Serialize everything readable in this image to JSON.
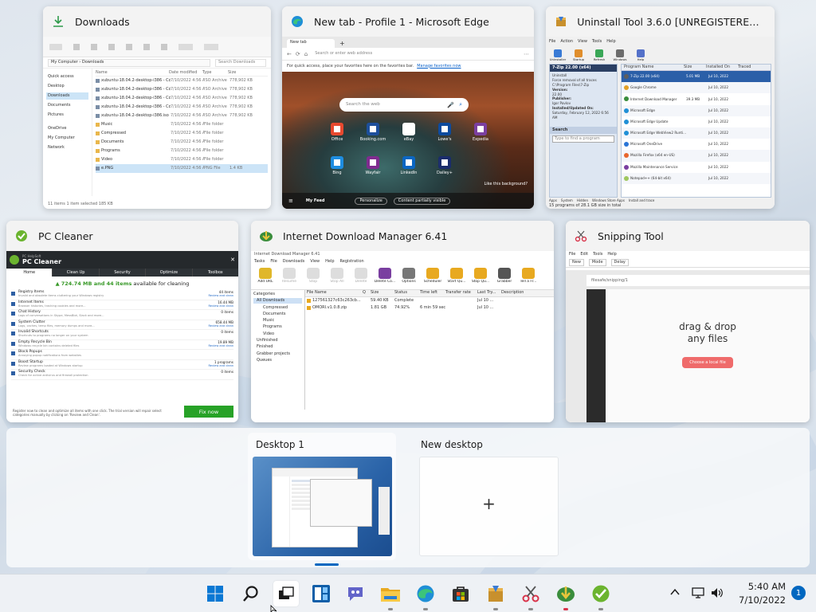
{
  "windows": {
    "downloads": {
      "title": "Downloads",
      "breadcrumb": "My Computer › Downloads",
      "search_placeholder": "Search Downloads",
      "sidebar": [
        "Quick access",
        "Desktop",
        "Downloads",
        "Documents",
        "Pictures",
        "OneDrive",
        "My Computer",
        "Network"
      ],
      "columns": [
        "Name",
        "Date modified",
        "Type",
        "Size"
      ],
      "files": [
        {
          "name": "xubuntu-18.04.2-desktop-i386 - Copy (3)...",
          "date": "7/10/2022 4:56 AM",
          "type": "ISO Archive",
          "size": "778,902 KB"
        },
        {
          "name": "xubuntu-18.04.2-desktop-i386 - Copy (2)...",
          "date": "7/10/2022 4:56 AM",
          "type": "ISO Archive",
          "size": "778,902 KB"
        },
        {
          "name": "xubuntu-18.04.2-desktop-i386 - Copy (4)...",
          "date": "7/10/2022 4:56 AM",
          "type": "ISO Archive",
          "size": "778,902 KB"
        },
        {
          "name": "xubuntu-18.04.2-desktop-i386 - Copy.iso",
          "date": "7/10/2022 4:56 AM",
          "type": "ISO Archive",
          "size": "778,902 KB"
        },
        {
          "name": "xubuntu-18.04.2-desktop-i386.iso",
          "date": "7/10/2022 4:56 AM",
          "type": "ISO Archive",
          "size": "778,902 KB"
        },
        {
          "name": "Music",
          "date": "7/10/2022 4:56 AM",
          "type": "File folder",
          "size": ""
        },
        {
          "name": "Compressed",
          "date": "7/10/2022 4:56 AM",
          "type": "File folder",
          "size": ""
        },
        {
          "name": "Documents",
          "date": "7/10/2022 4:56 AM",
          "type": "File folder",
          "size": ""
        },
        {
          "name": "Programs",
          "date": "7/10/2022 4:56 AM",
          "type": "File folder",
          "size": ""
        },
        {
          "name": "Video",
          "date": "7/10/2022 4:56 AM",
          "type": "File folder",
          "size": ""
        },
        {
          "name": "e.PNG",
          "date": "7/10/2022 4:56 AM",
          "type": "PNG File",
          "size": "1.4 KB"
        }
      ],
      "status": "11 items   1 item selected  185 KB"
    },
    "edge": {
      "title": "New tab - Profile 1 - Microsoft Edge",
      "tab_label": "New tab",
      "address_placeholder": "Search or enter web address",
      "favorites_hint": "For quick access, place your favorites here on the favorites bar.",
      "favorites_link": "Manage favorites now",
      "search_placeholder": "Search the web",
      "tiles": [
        "Office",
        "Booking.com",
        "eBay",
        "Lowe's",
        "Expedia",
        "Bing",
        "Wayfair",
        "LinkedIn",
        "Dailey+"
      ],
      "like_bg": "Like this background?",
      "my_feed": "My Feed",
      "personalize": "Personalize",
      "content_visible": "Content partially visible"
    },
    "uninstall": {
      "title": "Uninstall Tool 3.6.0 [UNREGISTERED V...",
      "menu": [
        "File",
        "Action",
        "View",
        "Tools",
        "Help"
      ],
      "toolbar": [
        "Uninstaller",
        "Startup",
        "Refresh",
        "Windows",
        "Help"
      ],
      "selected_app": "7-Zip 22.00 (x64)",
      "side_info": [
        "Uninstall",
        "Force removal of all traces",
        "C:\\Program Files\\7-Zip",
        "Version:",
        "22.00",
        "Publisher:",
        "Igor Pavlov",
        "Installed/Updated On:",
        "Saturday, February 12, 2022 6:56 AM"
      ],
      "search_label": "Search",
      "search_placeholder": "Type to find a program",
      "columns": [
        "Program Name",
        "Size",
        "Installed On",
        "Traced"
      ],
      "programs": [
        {
          "name": "7-Zip 22.00 (x64)",
          "size": "5.01 MB",
          "date": "Jul 10, 2022"
        },
        {
          "name": "Google Chrome",
          "size": "",
          "date": "Jul 10, 2022"
        },
        {
          "name": "Internet Download Manager",
          "size": "39.3 MB",
          "date": "Jul 10, 2022"
        },
        {
          "name": "Microsoft Edge",
          "size": "",
          "date": "Jul 10, 2022"
        },
        {
          "name": "Microsoft Edge Update",
          "size": "",
          "date": "Jul 10, 2022"
        },
        {
          "name": "Microsoft Edge WebView2 Runti...",
          "size": "",
          "date": "Jul 10, 2022"
        },
        {
          "name": "Microsoft OneDrive",
          "size": "",
          "date": "Jul 10, 2022"
        },
        {
          "name": "Mozilla Firefox (x64 en-US)",
          "size": "",
          "date": "Jul 10, 2022"
        },
        {
          "name": "Mozilla Maintenance Service",
          "size": "",
          "date": "Jul 10, 2022"
        },
        {
          "name": "Notepad++ (64-bit x64)",
          "size": "",
          "date": "Jul 10, 2022"
        }
      ],
      "filter_tabs": [
        "Apps",
        "System",
        "Hidden",
        "Windows Store Apps",
        "Install and trace"
      ],
      "status": "15 programs of 28.1 GB size in total"
    },
    "pccleaner": {
      "title": "PC Cleaner",
      "brand_top": "PC HelpSoft",
      "brand": "PC Cleaner",
      "tabs": [
        "Home",
        "Clean Up",
        "Security",
        "Optimize",
        "Toolbox"
      ],
      "summary_size": "724.74 MB and 44 items",
      "summary_rest": "available for cleaning",
      "rows": [
        {
          "title": "Registry Items",
          "desc": "Invalid and obsolete items cluttering your Windows registry",
          "count": "44 items",
          "link": "Review and clean"
        },
        {
          "title": "Internet Items",
          "desc": "Browser histories, tracking cookies and more...",
          "count": "16.44 MB",
          "link": "Review and clean"
        },
        {
          "title": "Chat History",
          "desc": "Logs of conversations in Skype, MessBlot, Slack and more...",
          "count": "0 items",
          "link": ""
        },
        {
          "title": "System Clutter",
          "desc": "Logs, caches, temp files, memory dumps and more...",
          "count": "658.44 MB",
          "link": "Review and clean"
        },
        {
          "title": "Invalid Shortcuts",
          "desc": "Shortcuts to programs no longer on your system",
          "count": "0 items",
          "link": ""
        },
        {
          "title": "Empty Recycle Bin",
          "desc": "Windows recycle bin contains deleted files",
          "count": "19.89 MB",
          "link": "Review and clean"
        },
        {
          "title": "Block Popups",
          "desc": "Annoying popup notifications from websites",
          "count": "",
          "link": ""
        },
        {
          "title": "Boost Startup",
          "desc": "Review programs loaded at Windows startup",
          "count": "1 programs",
          "link": "Review and clean"
        },
        {
          "title": "Security Check",
          "desc": "Check for active antivirus and firewall protection",
          "count": "0 items",
          "link": ""
        }
      ],
      "footer_note": "Register now to clean and optimize all items with one click. The trial version will repair select categories manually by clicking on 'Review and Clean'.",
      "fix_button": "Fix now"
    },
    "idm": {
      "title": "Internet Download Manager 6.41",
      "inner_title": "Internet Download Manager 6.41",
      "menu": [
        "Tasks",
        "File",
        "Downloads",
        "View",
        "Help",
        "Registration"
      ],
      "toolbar": [
        "Add URL",
        "Resume",
        "Stop",
        "Stop All",
        "Delete",
        "Delete Co...",
        "Options",
        "Scheduler",
        "Start Qu...",
        "Stop Qu...",
        "Grabber",
        "Tell a Fr..."
      ],
      "categories": [
        "Categories",
        "All Downloads",
        "Compressed",
        "Documents",
        "Music",
        "Programs",
        "Video",
        "Unfinished",
        "Finished",
        "Grabber projects",
        "Queues"
      ],
      "columns": [
        "File Name",
        "Q",
        "Size",
        "Status",
        "Time left",
        "Transfer rate",
        "Last Try...",
        "Description"
      ],
      "downloads": [
        {
          "name": "127561327c63c263cb...",
          "size": "59.40 KB",
          "status": "Complete",
          "time": "",
          "last": "Jul 10 ..."
        },
        {
          "name": "OMORI.v1.0.8.zip",
          "size": "1.81 GB",
          "status": "74.92%",
          "time": "6 min 59 sec",
          "last": "Jul 10 ..."
        }
      ]
    },
    "snipping": {
      "title": "Snipping Tool",
      "menu": [
        "File",
        "Edit",
        "Tools",
        "Help"
      ],
      "toolbar": [
        "New",
        "Mode",
        "Delay"
      ],
      "inner_url": "filesafe/snipping/1",
      "drop_text_1": "drag & drop",
      "drop_text_2": "any files",
      "choose_button": "Choose a local file"
    }
  },
  "desktops": {
    "current": "Desktop 1",
    "new": "New desktop",
    "plus": "+"
  },
  "taskbar": {
    "apps": [
      "start-icon",
      "search-icon",
      "task-view-icon",
      "widgets-icon",
      "chat-icon",
      "file-explorer-icon",
      "edge-icon",
      "store-icon",
      "uninstall-tool-icon",
      "snipping-tool-icon",
      "idm-icon",
      "pc-cleaner-icon"
    ],
    "time": "5:40 AM",
    "date": "7/10/2022",
    "notifications": "1"
  }
}
